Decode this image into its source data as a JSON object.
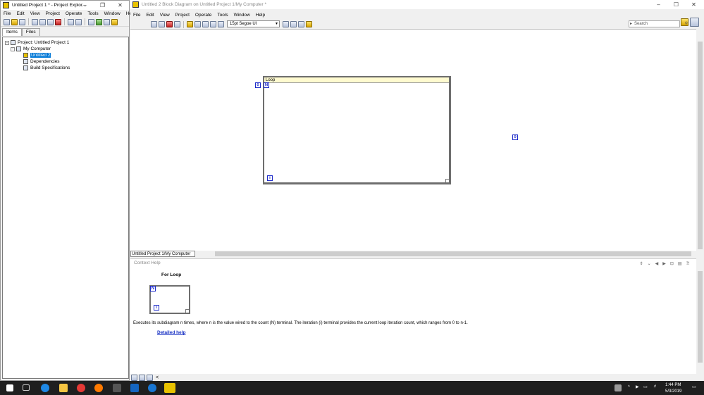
{
  "project_window": {
    "title": "Untitled Project 1 * - Project Explor...",
    "menu": [
      "File",
      "Edit",
      "View",
      "Project",
      "Operate",
      "Tools",
      "Window",
      "Help"
    ],
    "tabs": [
      "Items",
      "Files"
    ],
    "tree": [
      {
        "label": "Project: Untitled Project 1",
        "icon": "project-icon"
      },
      {
        "label": "My Computer",
        "icon": "computer-icon"
      },
      {
        "label": "Untitled 2",
        "icon": "vi-icon",
        "selected": true
      },
      {
        "label": "Dependencies",
        "icon": "dependencies-icon"
      },
      {
        "label": "Build Specifications",
        "icon": "build-icon"
      }
    ]
  },
  "diagram_window": {
    "title": "Untitled 2 Block Diagram on Untitled Project 1/My Computer *",
    "menu": [
      "File",
      "Edit",
      "View",
      "Project",
      "Operate",
      "Tools",
      "Window",
      "Help"
    ],
    "font_select": "15pt Segoe UI",
    "search_placeholder": "Search",
    "path": "Untitled Project 1/My Computer",
    "loop_label": "Loop",
    "count_terminal": "N",
    "iteration_terminal": "i",
    "constant_terminal": "0"
  },
  "context_help": {
    "title": "Context Help",
    "heading": "For Loop",
    "description": "Executes its subdiagram n times, where n is the value wired to the count (N) terminal. The iteration (i) terminal provides the current loop iteration count, which ranges from 0 to n-1.",
    "link": "Detailed help",
    "count_terminal": "N",
    "iteration_terminal": "i"
  },
  "taskbar": {
    "time": "1:44 PM",
    "date": "5/3/2019"
  },
  "colors": {
    "terminal_blue": "#1c2ac9",
    "loop_label_bg": "#fffbd0",
    "selection": "#0078d7",
    "link": "#1a33c4"
  }
}
